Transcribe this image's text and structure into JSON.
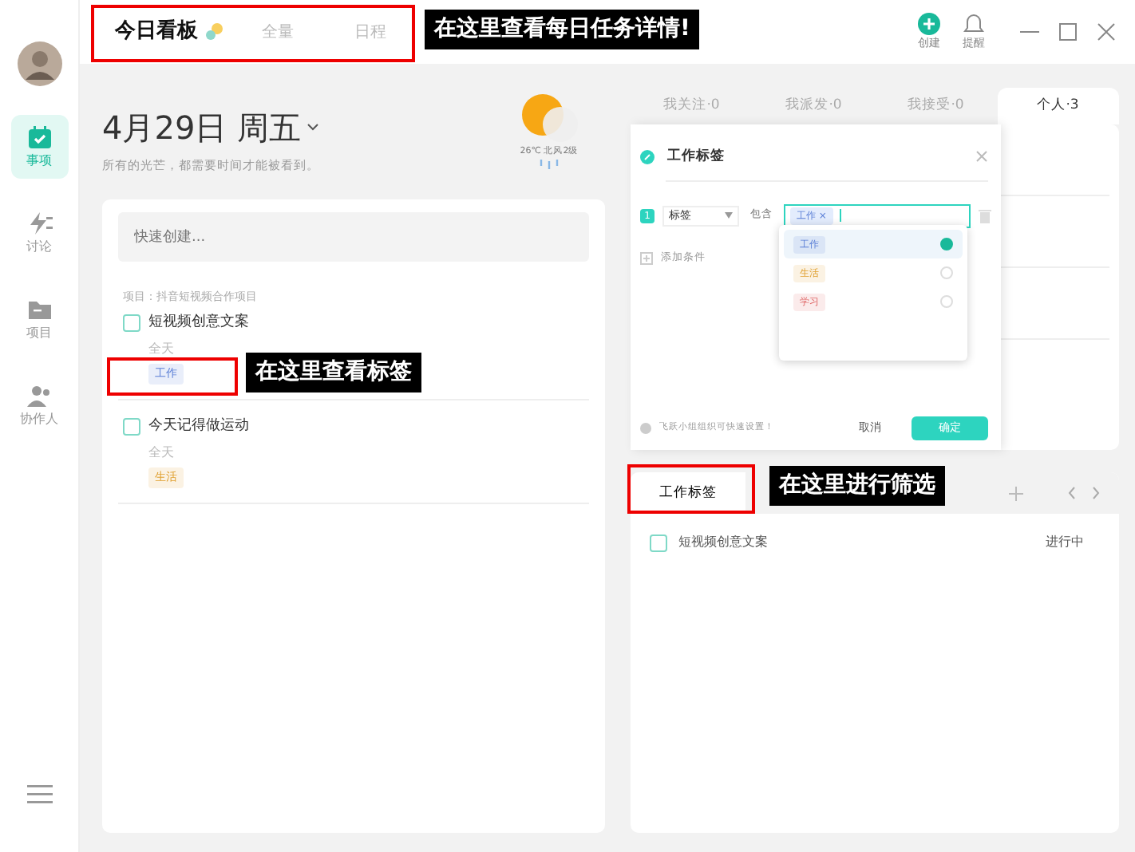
{
  "sidebar": {
    "items": [
      {
        "label": "事项",
        "kind": "calendar",
        "selected": true
      },
      {
        "label": "讨论",
        "kind": "bolt",
        "selected": false
      },
      {
        "label": "项目",
        "kind": "folder",
        "selected": false
      },
      {
        "label": "协作人",
        "kind": "people",
        "selected": false
      }
    ]
  },
  "top_tabs": [
    {
      "label": "今日看板",
      "selected": true
    },
    {
      "label": "全量",
      "selected": false
    },
    {
      "label": "日程",
      "selected": false
    }
  ],
  "toolbar": [
    {
      "label": "创建",
      "kind": "create"
    },
    {
      "label": "提醒",
      "kind": "bell"
    }
  ],
  "date": {
    "title": "4月29日 周五",
    "motto": "所有的光芒，都需要时间才能被看到。",
    "weather": "26℃ 北风2级"
  },
  "quick_create": {
    "placeholder": "快速创建..."
  },
  "project_label": "项目：抖音短视频合作项目",
  "tasks": [
    {
      "title": "短视频创意文案",
      "time": "全天",
      "checked": false,
      "tag": {
        "label": "工作",
        "color": "#5b7fd6"
      }
    },
    {
      "title": "今天记得做运动",
      "time": "全天",
      "checked": false,
      "tag": {
        "label": "生活",
        "color": "#e0a030"
      }
    }
  ],
  "right_tabs": [
    {
      "label": "我关注·0",
      "selected": false
    },
    {
      "label": "我派发·0",
      "selected": false
    },
    {
      "label": "我接受·0",
      "selected": false
    },
    {
      "label": "个人·3",
      "selected": true
    }
  ],
  "filter_dialog": {
    "title": "工作标签",
    "condition": {
      "number": "1",
      "field": "标签",
      "operator": "包含",
      "chips": [
        "工作 ×"
      ]
    },
    "options": [
      {
        "label": "工作",
        "color": "#5b7fd6",
        "selected": true
      },
      {
        "label": "生活",
        "color": "#e0a030",
        "selected": false
      },
      {
        "label": "学习",
        "color": "#e06a6a",
        "selected": false
      }
    ],
    "add_condition": "添加条件",
    "hint": "飞跃小组组织可快速设置！",
    "cancel": "取消",
    "confirm": "确定"
  },
  "view_tabs": [
    {
      "label": "工作标签",
      "selected": true
    }
  ],
  "results": [
    {
      "title": "短视频创意文案",
      "status": "进行中",
      "checked": false
    }
  ],
  "annotations": [
    {
      "text": "在这里查看每日任务详情!"
    },
    {
      "text": "在这里查看标签"
    },
    {
      "text": "在这里进行筛选"
    }
  ]
}
